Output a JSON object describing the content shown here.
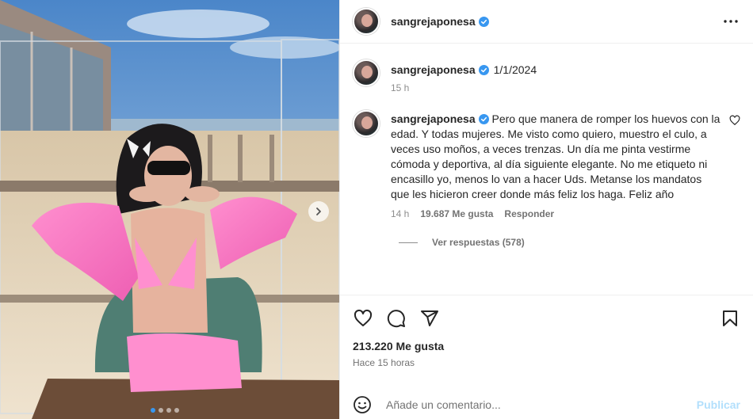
{
  "post": {
    "username": "sangrejaponesa",
    "date": "1/1/2024",
    "caption_time": "15 h",
    "likes": "213.220 Me gusta",
    "posted_ago": "Hace 15 horas"
  },
  "comment": {
    "username": "sangrejaponesa",
    "text": "Pero que manera de romper los huevos con la edad. Y todas mujeres. Me visto como quiero, muestro el culo, a veces uso moños, a veces trenzas. Un día me pinta vestirme cómoda y deportiva, al día siguiente elegante. No me etiqueto ni encasillo yo, menos lo van a hacer Uds. Metanse los mandatos que les hicieron creer donde más feliz los haga. Feliz año",
    "time": "14 h",
    "likes": "19.687 Me gusta",
    "reply_label": "Responder",
    "view_replies": "Ver respuestas (578)"
  },
  "composer": {
    "placeholder": "Añade un comentario...",
    "post_label": "Publicar"
  },
  "carousel": {
    "count": 4,
    "active": 0
  },
  "colors": {
    "verified": "#3897f0",
    "post_disabled": "#b2dffc"
  },
  "icons": [
    "more-icon",
    "verified-icon",
    "heart-icon",
    "comment-icon",
    "share-icon",
    "bookmark-icon",
    "emoji-icon",
    "chevron-right-icon"
  ]
}
